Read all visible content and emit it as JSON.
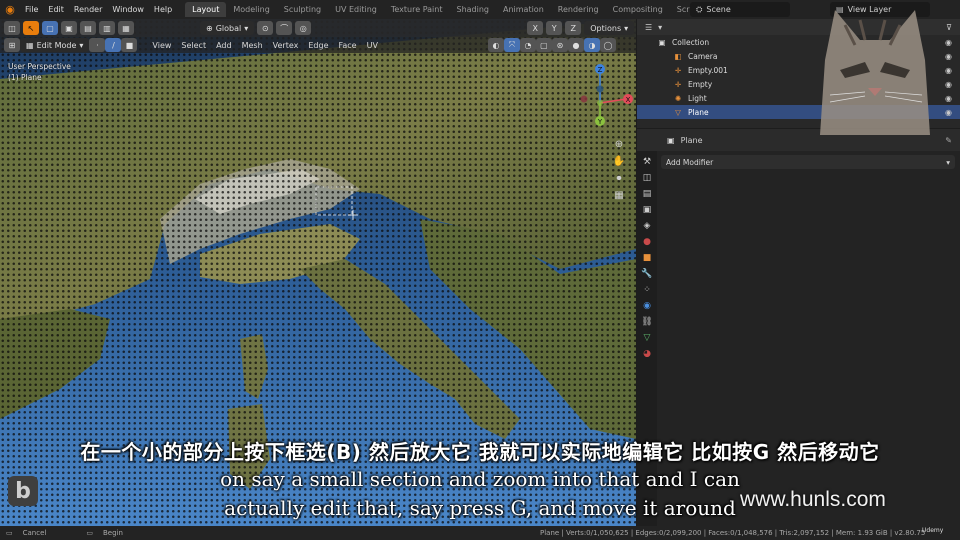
{
  "menu": {
    "items": [
      "File",
      "Edit",
      "Render",
      "Window",
      "Help"
    ]
  },
  "workspace_tabs": [
    "Layout",
    "Modeling",
    "Sculpting",
    "UV Editing",
    "Texture Paint",
    "Shading",
    "Animation",
    "Rendering",
    "Compositing",
    "Scripting"
  ],
  "active_tab": "Layout",
  "scene": {
    "label": "Scene"
  },
  "view_layer": {
    "label": "View Layer"
  },
  "viewport": {
    "transform_orientation": "Global",
    "options_label": "Options",
    "mode": "Edit Mode",
    "view_menus": [
      "View",
      "Select",
      "Add",
      "Mesh",
      "Vertex",
      "Edge",
      "Face",
      "UV"
    ],
    "perspective_label": "User Perspective",
    "object_label": "(1) Plane",
    "axes": {
      "x": "X",
      "y": "Y",
      "z": "Z"
    }
  },
  "outliner": {
    "items": [
      {
        "label": "Collection",
        "icon": "collection-icon",
        "selected": false
      },
      {
        "label": "Camera",
        "icon": "camera-icon",
        "selected": false
      },
      {
        "label": "Empty.001",
        "icon": "empty-icon",
        "selected": false
      },
      {
        "label": "Empty",
        "icon": "empty-icon",
        "selected": false
      },
      {
        "label": "Light",
        "icon": "light-icon",
        "selected": false
      },
      {
        "label": "Plane",
        "icon": "mesh-icon",
        "selected": true
      }
    ]
  },
  "properties": {
    "object_name": "Plane",
    "add_modifier_label": "Add Modifier"
  },
  "statusbar": {
    "cancel_label": "Cancel",
    "begin_label": "Begin",
    "stats": "Plane | Verts:0/1,050,625 | Edges:0/2,099,200 | Faces:0/1,048,576 | Tris:2,097,152 | Mem: 1.93 GiB | v2.80.75"
  },
  "subtitles": {
    "chinese": "在一个小的部分上按下框选(B) 然后放大它 我就可以实际地编辑它 比如按G 然后移动它",
    "english_line1": "on say a small section and zoom into that and I can",
    "english_line2": "actually edit that, say press G, and move it around"
  },
  "watermark": "www.hunls.com",
  "logo_letter": "b",
  "udemy_label": "Udemy",
  "colors": {
    "active_tab_bg": "#3d3d3d",
    "selection": "#334d80",
    "accent_blue": "#4772b3",
    "axis_x": "#e44b5a",
    "axis_y": "#8bc13f",
    "axis_z": "#3c82e0"
  }
}
